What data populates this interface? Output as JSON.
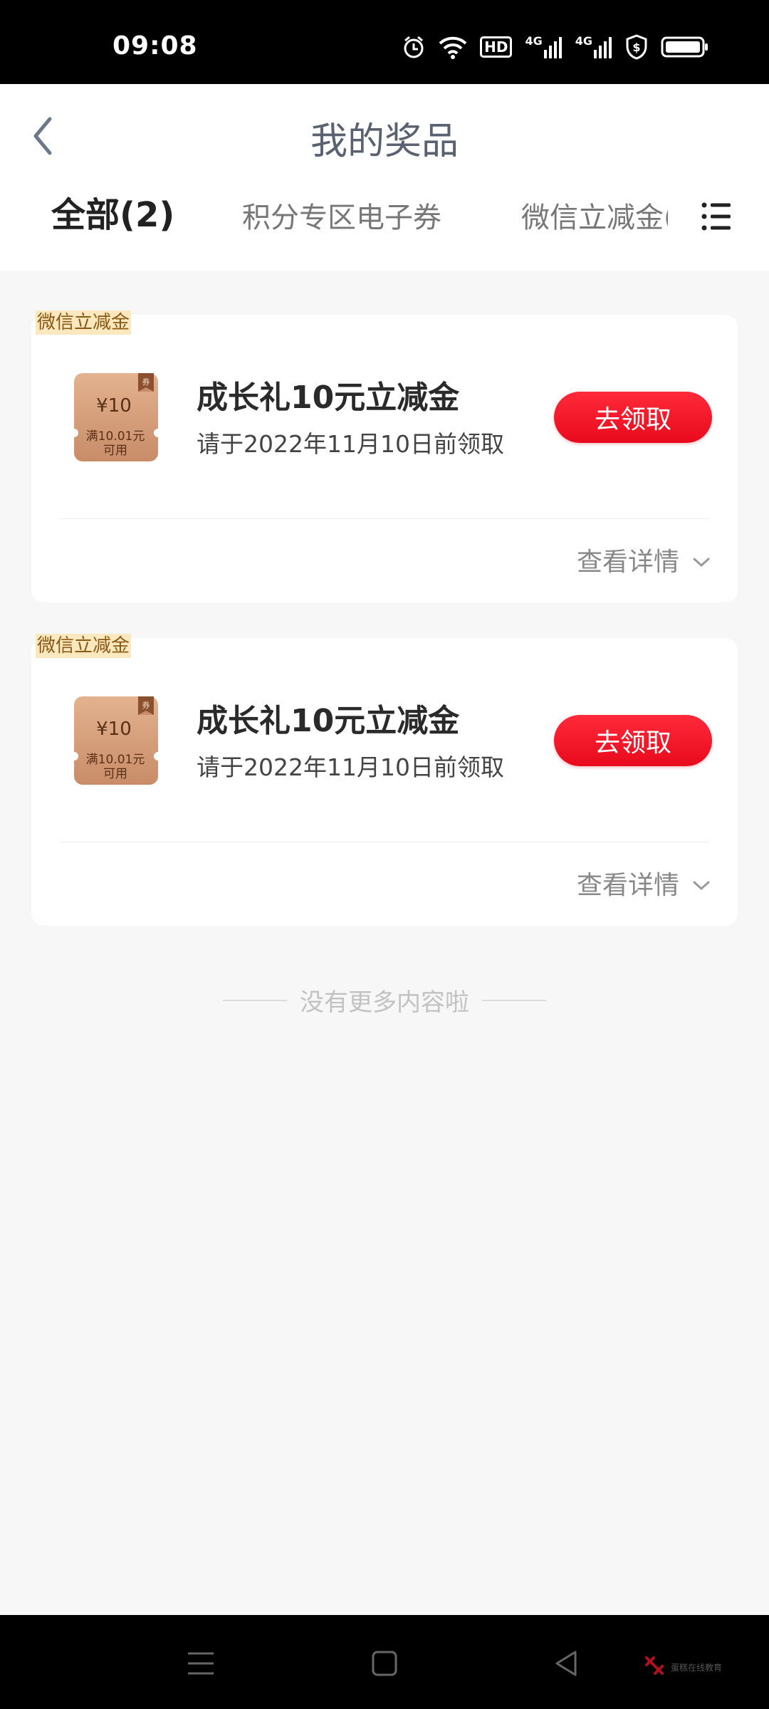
{
  "status_bar": {
    "time": "09:08",
    "icons": [
      "alarm-icon",
      "wifi-icon",
      "hd-icon",
      "signal-4g-icon",
      "signal-4g-icon",
      "shield-icon",
      "battery-icon"
    ],
    "hd_label": "HD",
    "network_label": "4G"
  },
  "header": {
    "title": "我的奖品",
    "tabs": [
      {
        "label": "全部(2)",
        "active": true
      },
      {
        "label": "积分专区电子券",
        "active": false
      },
      {
        "label": "微信立减金(",
        "active": false
      }
    ]
  },
  "cards": [
    {
      "badge": "微信立减金",
      "coupon_amount": "¥10",
      "coupon_condition_1": "满10.01元",
      "coupon_condition_2": "可用",
      "coupon_tag": "券",
      "title": "成长礼10元立减金",
      "deadline": "请于2022年11月10日前领取",
      "claim_label": "去领取",
      "details_label": "查看详情"
    },
    {
      "badge": "微信立减金",
      "coupon_amount": "¥10",
      "coupon_condition_1": "满10.01元",
      "coupon_condition_2": "可用",
      "coupon_tag": "券",
      "title": "成长礼10元立减金",
      "deadline": "请于2022年11月10日前领取",
      "claim_label": "去领取",
      "details_label": "查看详情"
    }
  ],
  "end_text": "没有更多内容啦",
  "colors": {
    "accent": "#e02030",
    "claim_button": "#f5142a",
    "badge_bg": "#fbe8bf",
    "coupon": "#c8906a"
  },
  "nav_bar": {
    "watermark_text": "蛋糕在线教育"
  }
}
